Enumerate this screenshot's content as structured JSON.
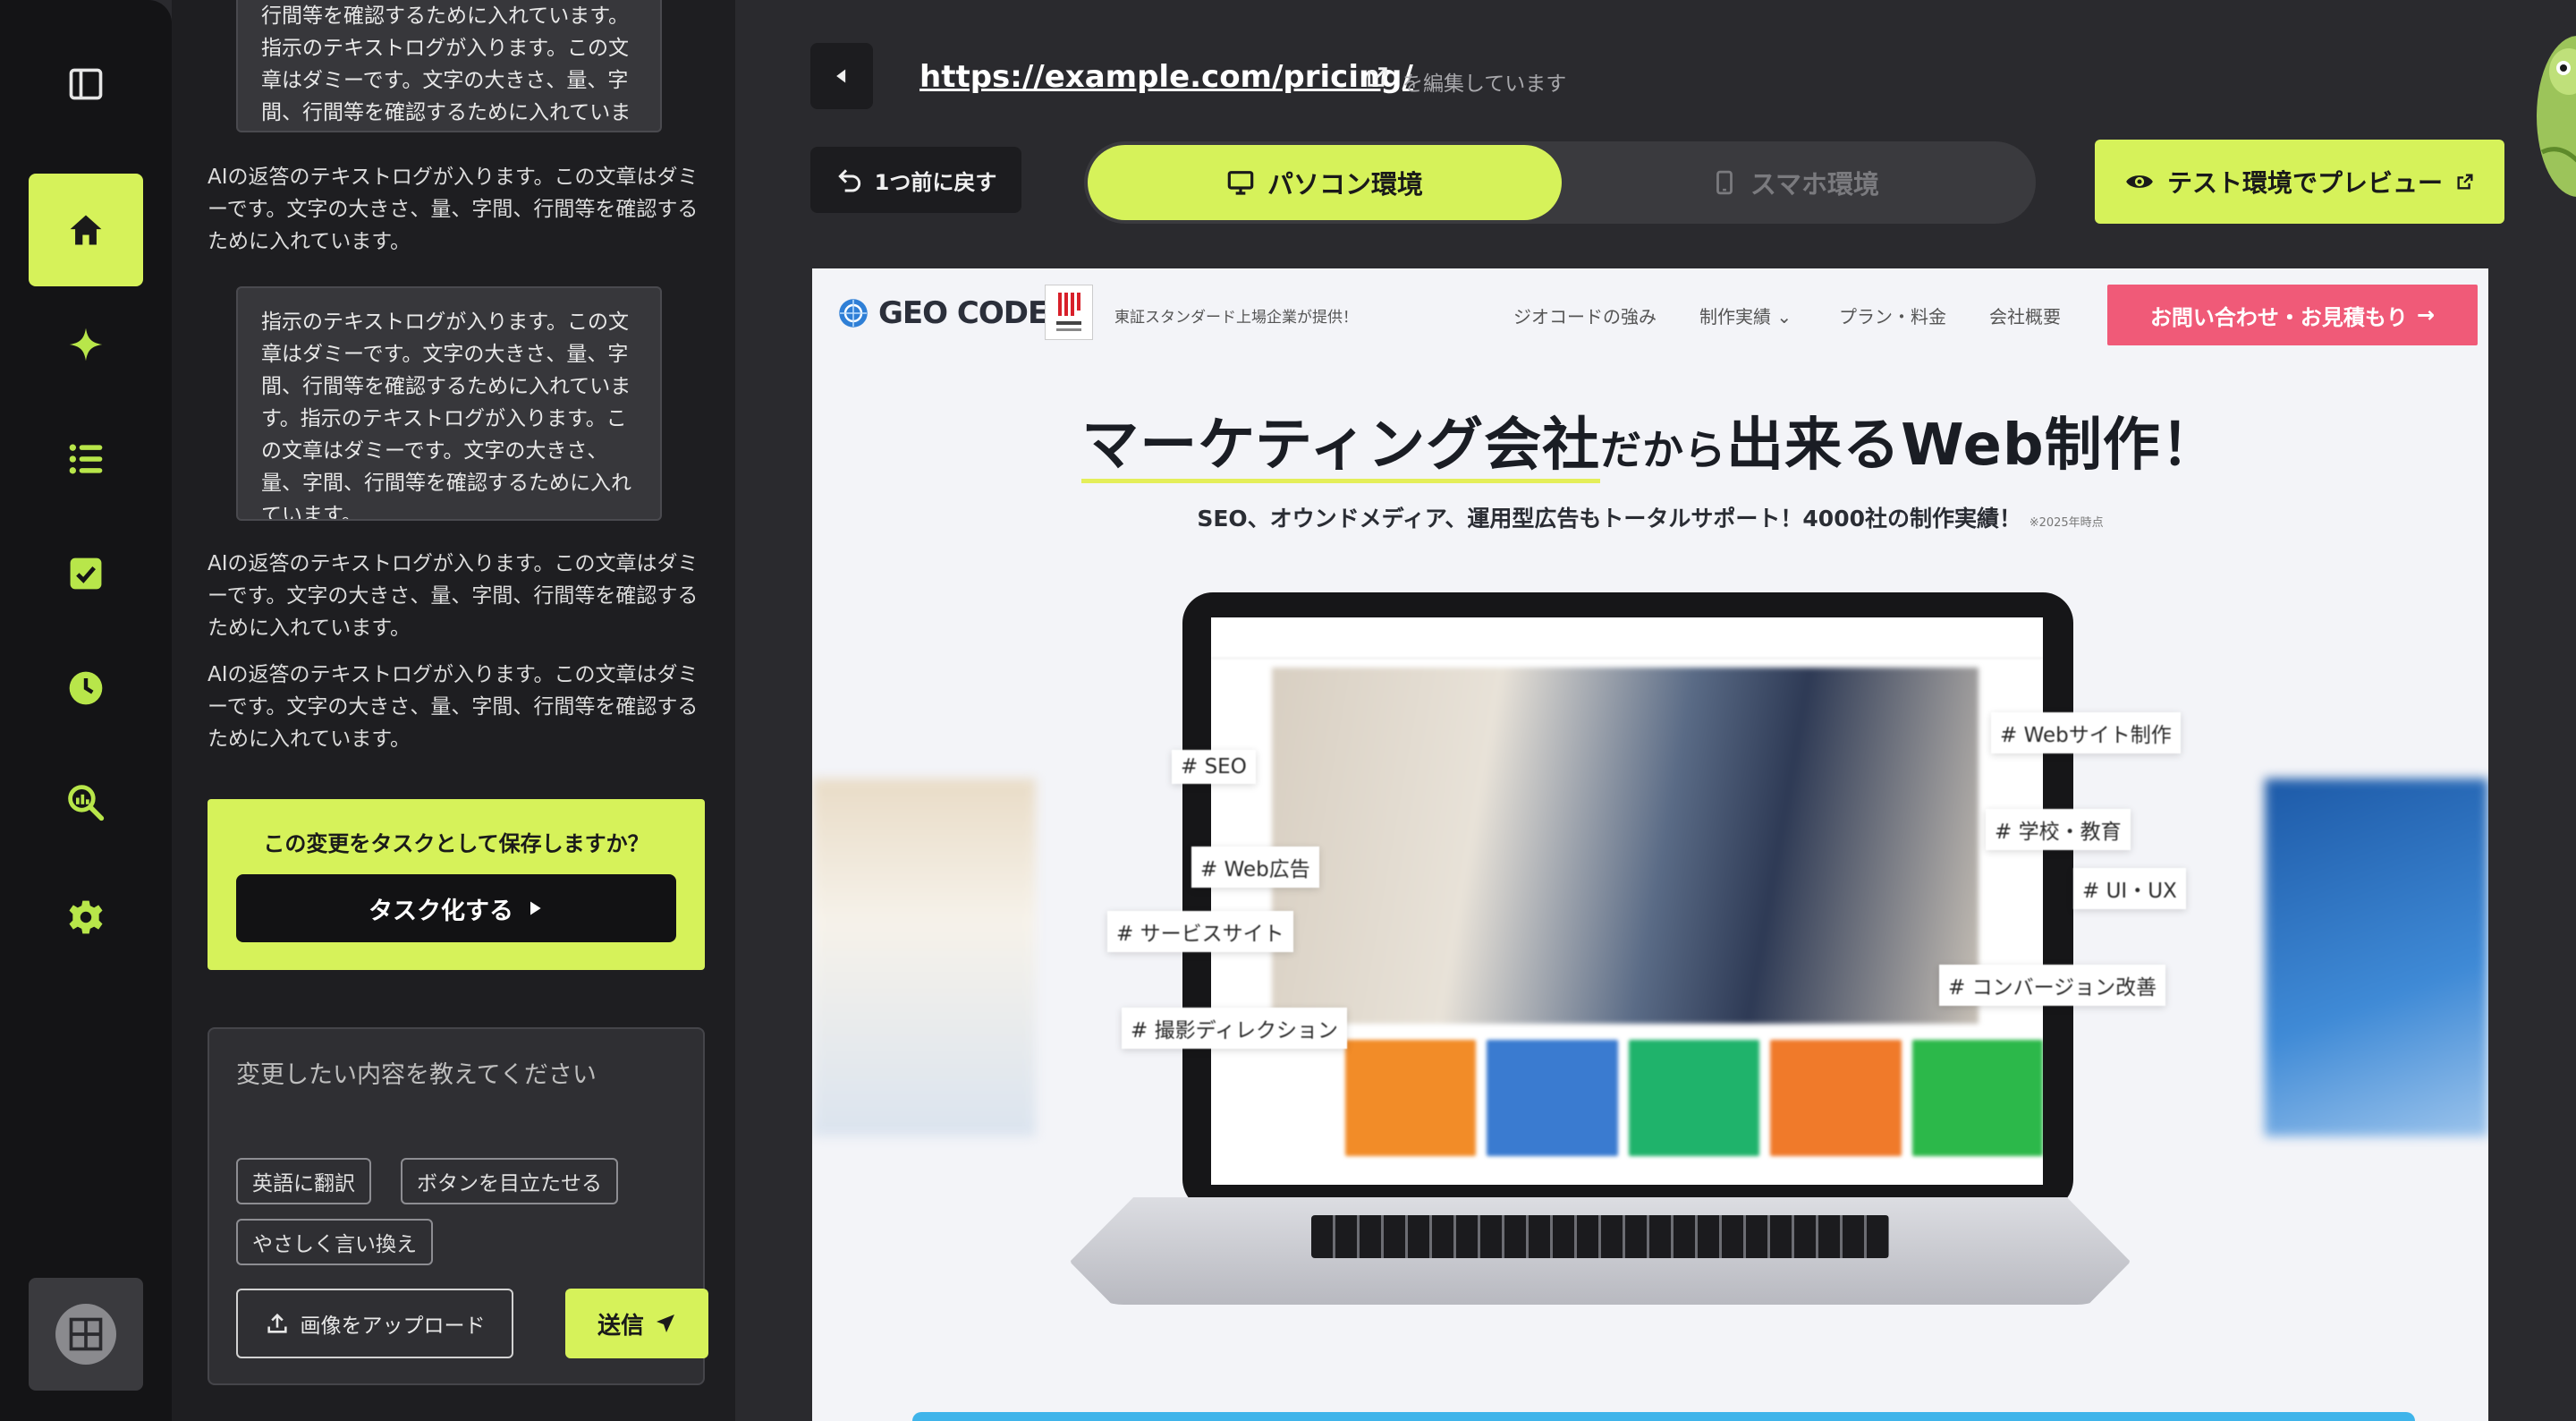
{
  "rail": {
    "items": [
      {
        "name": "home",
        "active": true
      },
      {
        "name": "sparkle",
        "active": false
      },
      {
        "name": "list",
        "active": false
      },
      {
        "name": "check",
        "active": false
      },
      {
        "name": "history",
        "active": false
      },
      {
        "name": "search-analytics",
        "active": false
      },
      {
        "name": "settings",
        "active": false
      }
    ],
    "bottom_icon": "grid-icon"
  },
  "chat": {
    "messages": [
      {
        "role": "user",
        "text": "行間等を確認するために入れています。指示のテキストログが入ります。この文章はダミーです。文字の大きさ、量、字間、行間等を確認するために入れています。"
      },
      {
        "role": "ai",
        "text": "AIの返答のテキストログが入ります。この文章はダミーです。文字の大きさ、量、字間、行間等を確認するために入れています。"
      },
      {
        "role": "user",
        "text": "指示のテキストログが入ります。この文章はダミーです。文字の大きさ、量、字間、行間等を確認するために入れています。指示のテキストログが入ります。この文章はダミーです。文字の大きさ、量、字間、行間等を確認するために入れています。"
      },
      {
        "role": "ai",
        "text": "AIの返答のテキストログが入ります。この文章はダミーです。文字の大きさ、量、字間、行間等を確認するために入れています。"
      },
      {
        "role": "ai",
        "text": "AIの返答のテキストログが入ります。この文章はダミーです。文字の大きさ、量、字間、行間等を確認するために入れています。"
      }
    ],
    "task_prompt": {
      "question": "この変更をタスクとして保存しますか？",
      "button_label": "タスク化する"
    },
    "composer": {
      "placeholder": "変更したい内容を教えてください",
      "chips": [
        "英語に翻訳",
        "ボタンを目立たせる",
        "やさしく言い換え"
      ],
      "upload_label": "画像をアップロード",
      "send_label": "送信"
    }
  },
  "editor": {
    "url": "https://example.com/pricing/",
    "editing_note": "を編集しています",
    "undo_label": "1つ前に戻す",
    "device_tabs": [
      {
        "label": "パソコン環境",
        "active": true
      },
      {
        "label": "スマホ環境",
        "active": false
      }
    ],
    "preview_label": "テスト環境でプレビュー"
  },
  "preview": {
    "logo_text": "GEO CODE",
    "tagline": "東証スタンダード上場企業が提供！",
    "nav": [
      "ジオコードの強み",
      "制作実績",
      "プラン・料金",
      "会社概要"
    ],
    "contact_label": "お問い合わせ・お見積もり",
    "hero_title_a": "マーケティング会社",
    "hero_title_b": "だから",
    "hero_title_c": "出来るWeb制作！",
    "hero_sub": "SEO、オウンドメディア、運用型広告もトータルサポート！4000社の制作実績！",
    "hero_sub_note": "※2025年時点",
    "hashtags": [
      "# SEO",
      "# Web広告",
      "# サービスサイト",
      "# 撮影ディレクション",
      "# Webサイト制作",
      "# 学校・教育",
      "# UI・UX",
      "# コンバージョン改善"
    ]
  },
  "colors": {
    "accent": "#d6f25a",
    "rail_bg": "#141416",
    "panel_bg": "#1e1e21",
    "app_bg": "#2a2a2e",
    "contact_pink": "#f05a78"
  }
}
